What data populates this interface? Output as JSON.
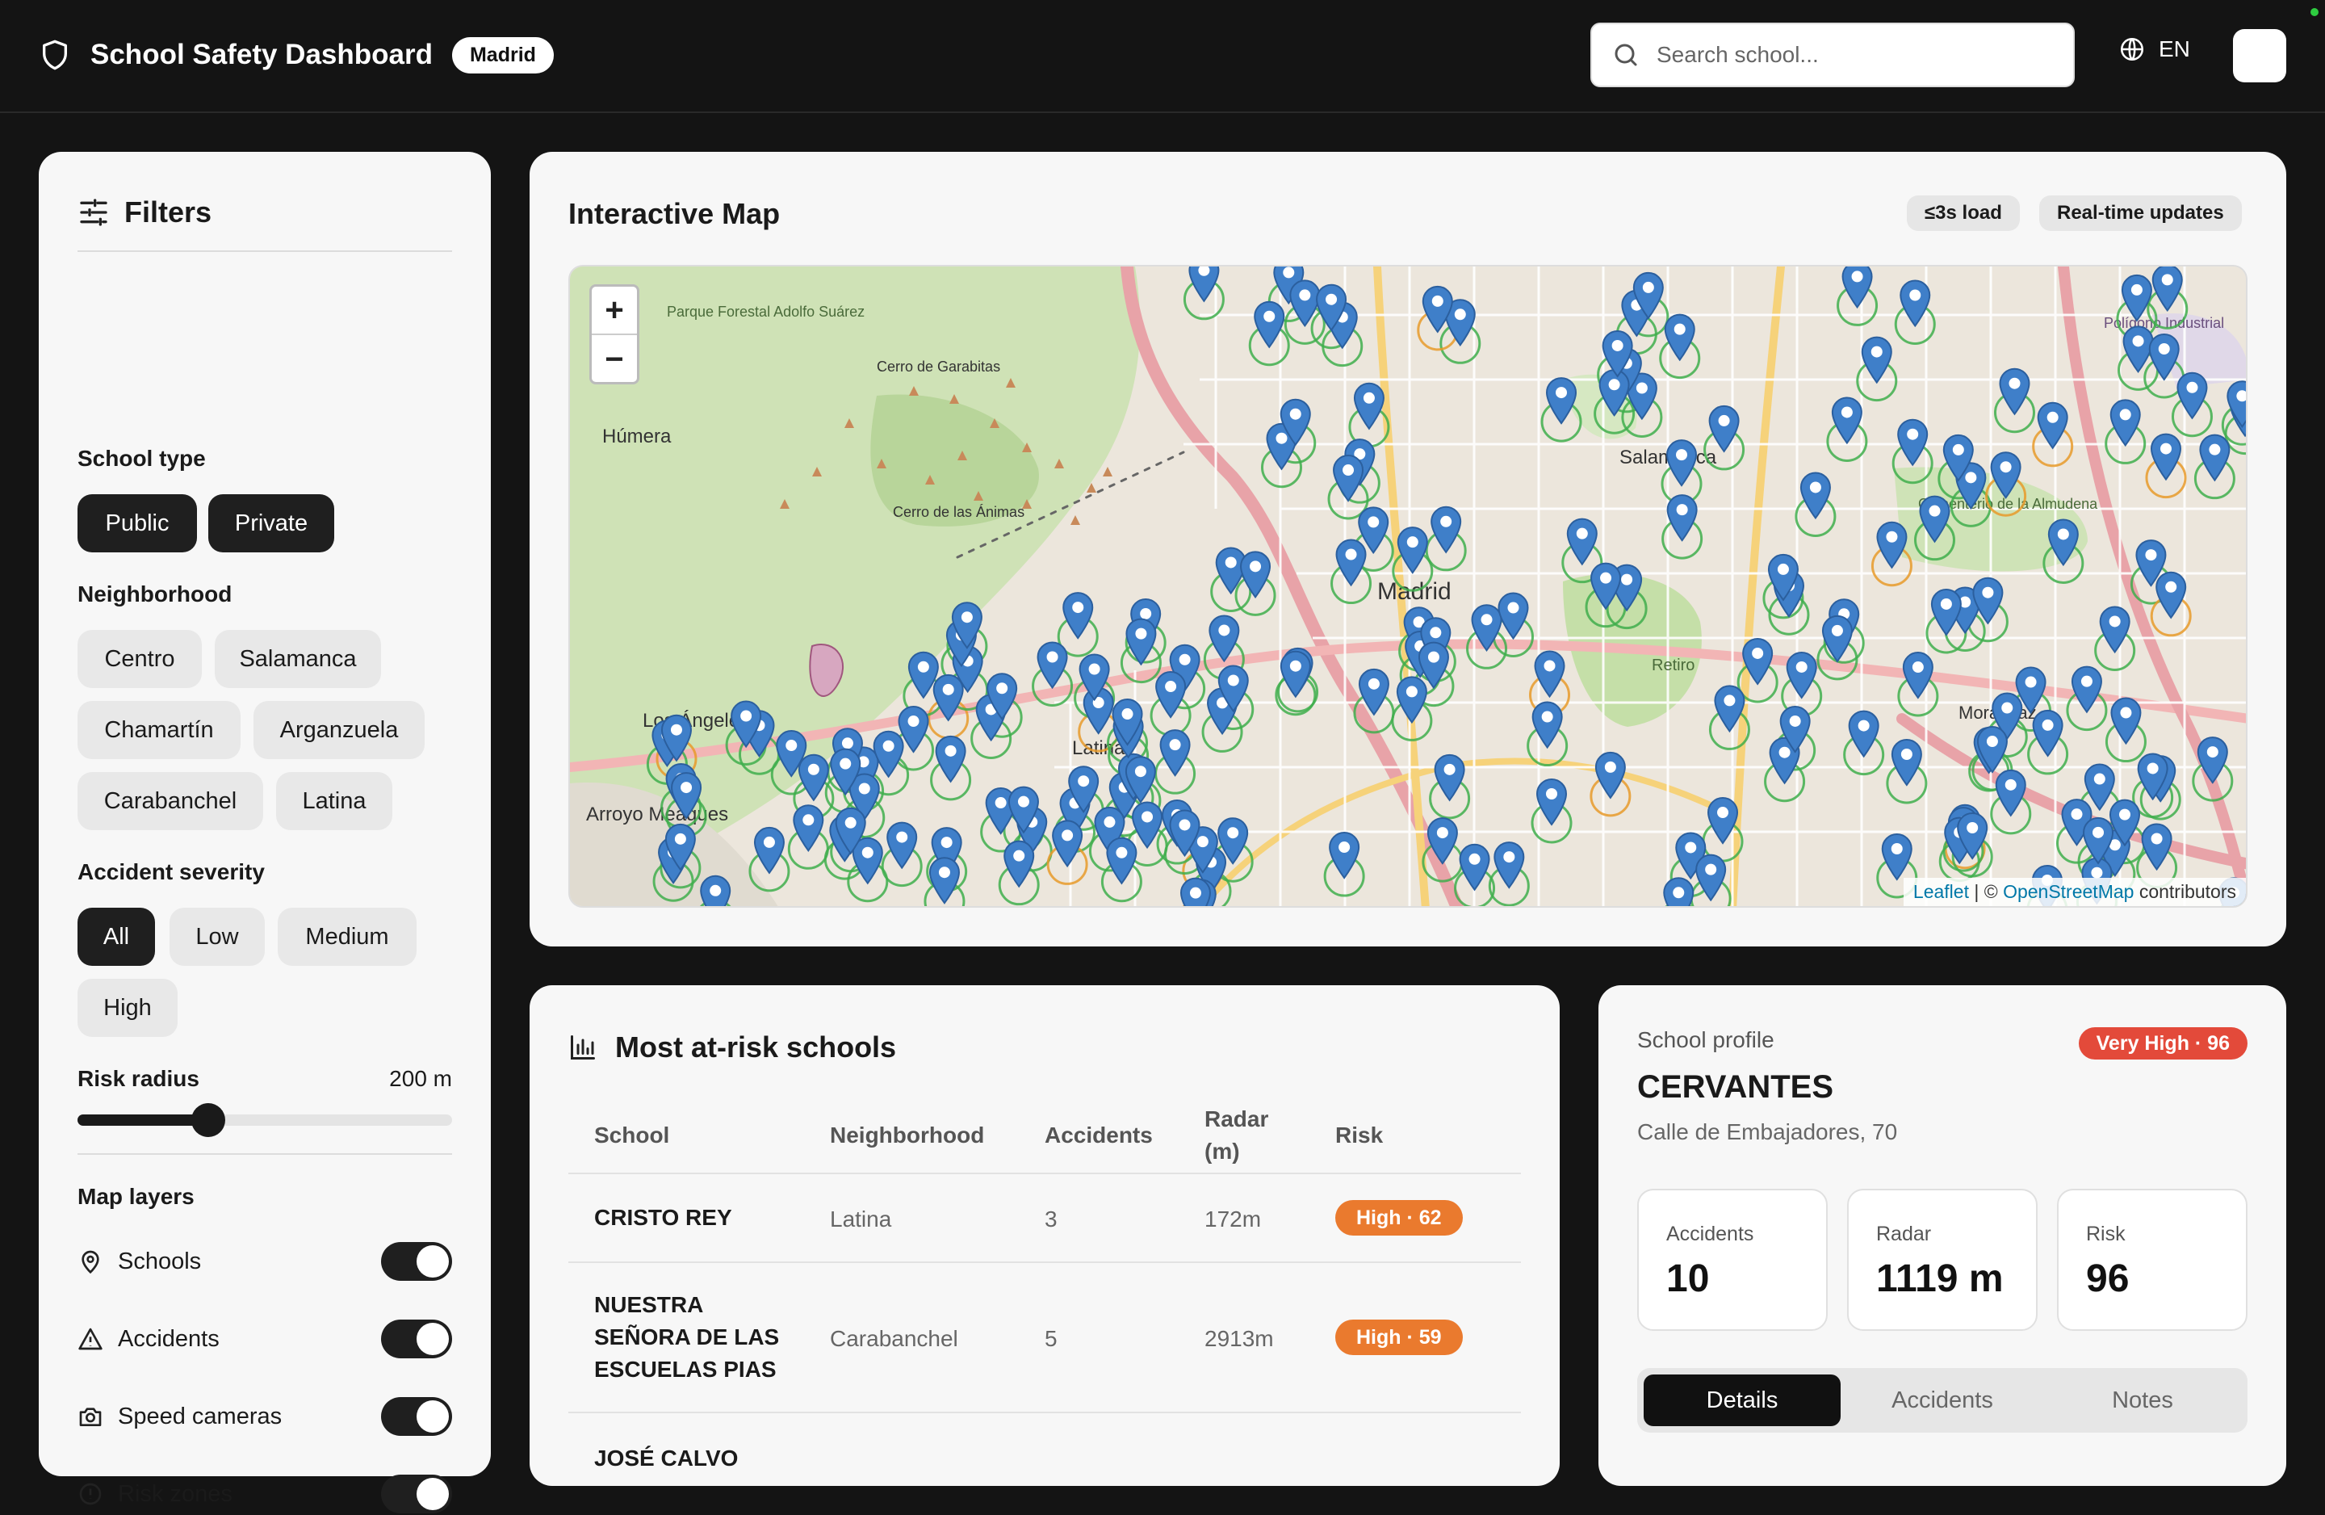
{
  "header": {
    "title": "School Safety Dashboard",
    "city": "Madrid",
    "search_placeholder": "Search school...",
    "language": "EN"
  },
  "filters": {
    "title": "Filters",
    "school_type": {
      "label": "School type",
      "options": [
        "Public",
        "Private"
      ],
      "selected": [
        "Public",
        "Private"
      ]
    },
    "neighborhood": {
      "label": "Neighborhood",
      "options": [
        "Centro",
        "Salamanca",
        "Chamartín",
        "Arganzuela",
        "Carabanchel",
        "Latina"
      ]
    },
    "severity": {
      "label": "Accident severity",
      "options": [
        "All",
        "Low",
        "Medium",
        "High"
      ],
      "selected": "All"
    },
    "risk_radius": {
      "label": "Risk radius",
      "value_label": "200 m",
      "fraction": 0.35
    },
    "layers": {
      "label": "Map layers",
      "items": [
        {
          "label": "Schools",
          "on": true
        },
        {
          "label": "Accidents",
          "on": true
        },
        {
          "label": "Speed cameras",
          "on": true
        },
        {
          "label": "Risk zones",
          "on": true
        }
      ]
    }
  },
  "map": {
    "title": "Interactive Map",
    "pills": [
      "≤3s load",
      "Real-time updates"
    ],
    "zoom_in": "+",
    "zoom_out": "−",
    "labels": [
      "Madrid",
      "Salamanca",
      "Latina",
      "Los Ángeles",
      "Húmera",
      "Arroyo Meaques",
      "Retiro",
      "Moratalaz",
      "Cementerio de la Almudena",
      "Parque Forestal Adolfo Suárez",
      "Cerro de Garabitas",
      "Cerro de las Ánimas",
      "Polígono Industrial"
    ],
    "attribution": {
      "leaflet": "Leaflet",
      "sep": " | © ",
      "osm": "OpenStreetMap",
      "tail": " contributors"
    }
  },
  "table": {
    "title": "Most at-risk schools",
    "columns": [
      "School",
      "Neighborhood",
      "Accidents",
      "Radar (m)",
      "Risk"
    ],
    "rows": [
      {
        "school": "CRISTO REY",
        "neighborhood": "Latina",
        "accidents": "3",
        "radar": "172m",
        "risk": "High · 62"
      },
      {
        "school": "NUESTRA SEÑORA DE LAS ESCUELAS PIAS",
        "neighborhood": "Carabanchel",
        "accidents": "5",
        "radar": "2913m",
        "risk": "High · 59"
      },
      {
        "school": "JOSÉ CALVO",
        "neighborhood": "",
        "accidents": "",
        "radar": "",
        "risk": ""
      }
    ]
  },
  "profile": {
    "kicker": "School profile",
    "risk_badge": "Very High · 96",
    "name": "CERVANTES",
    "address": "Calle de Embajadores, 70",
    "stats": [
      {
        "label": "Accidents",
        "value": "10"
      },
      {
        "label": "Radar",
        "value": "1119 m"
      },
      {
        "label": "Risk",
        "value": "96"
      }
    ],
    "tabs": [
      "Details",
      "Accidents",
      "Notes"
    ],
    "active_tab": "Details"
  },
  "colors": {
    "header_bg": "#141414",
    "card_bg": "#f7f7f7",
    "chip_on": "#1f1f1f",
    "risk_high": "#ea7a2e",
    "risk_very_high": "#e34a3a",
    "marker_blue": "#3f7fc9",
    "risk_ring_green": "#3fae4c",
    "risk_ring_orange": "#e79a2a"
  }
}
